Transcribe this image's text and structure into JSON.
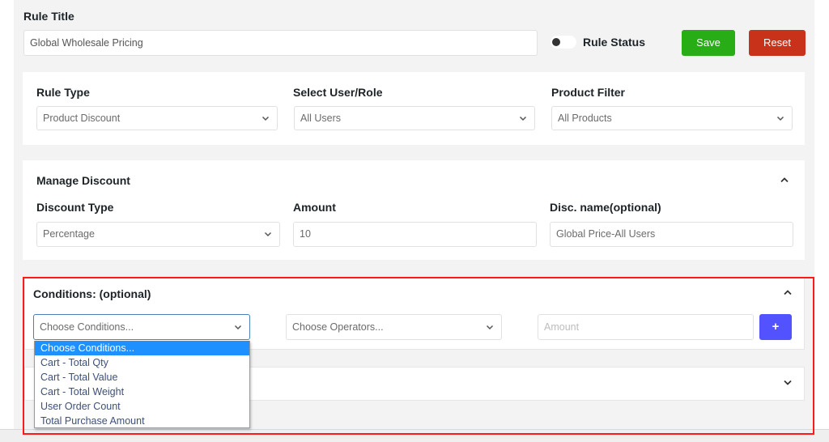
{
  "header": {
    "rule_title_label": "Rule Title",
    "rule_title_value": "Global Wholesale Pricing",
    "rule_status_label": "Rule Status",
    "rule_status_on": false,
    "save_label": "Save",
    "reset_label": "Reset"
  },
  "rule_settings": {
    "rule_type_label": "Rule Type",
    "rule_type_value": "Product Discount",
    "user_role_label": "Select User/Role",
    "user_role_value": "All Users",
    "product_filter_label": "Product Filter",
    "product_filter_value": "All Products"
  },
  "manage_discount": {
    "title": "Manage Discount",
    "discount_type_label": "Discount Type",
    "discount_type_value": "Percentage",
    "amount_label": "Amount",
    "amount_value": "10",
    "disc_name_label": "Disc. name(optional)",
    "disc_name_value": "Global Price-All Users"
  },
  "conditions": {
    "title": "Conditions: (optional)",
    "condition_select_value": "Choose Conditions...",
    "operator_select_value": "Choose Operators...",
    "amount_placeholder": "Amount",
    "add_label": "+",
    "condition_options": [
      "Choose Conditions...",
      "Cart - Total Qty",
      "Cart - Total Value",
      "Cart - Total Weight",
      "User Order Count",
      "Total Purchase Amount"
    ],
    "selected_option_index": 0
  },
  "colors": {
    "save": "#28ad17",
    "reset": "#c8321a",
    "add": "#5252ff",
    "highlight": "#ff1a1a",
    "selected_option": "#1e90ff"
  }
}
